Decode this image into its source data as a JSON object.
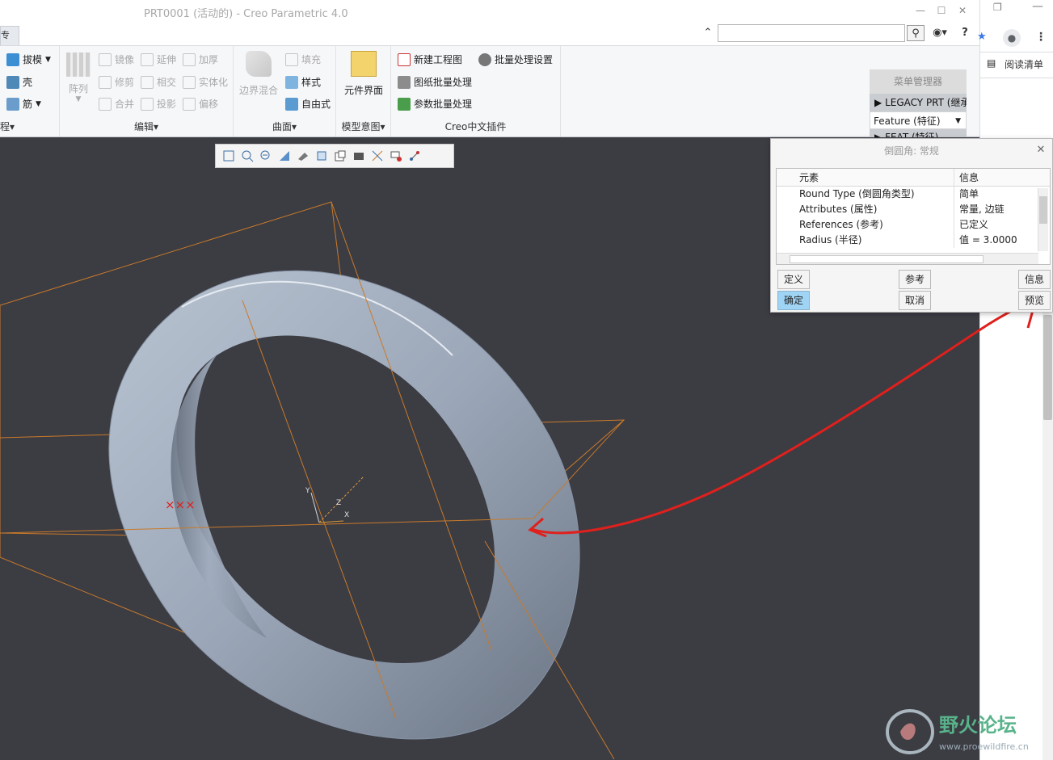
{
  "window": {
    "title": "PRT0001 (活动的) - Creo Parametric 4.0",
    "tab_stub": "专"
  },
  "ribbon": {
    "group0": {
      "label": "程",
      "items": [
        "拔模",
        "壳",
        "筋"
      ]
    },
    "group_edit": {
      "label": "编辑",
      "pattern": "阵列",
      "items": [
        "镜像",
        "延伸",
        "加厚",
        "修剪",
        "相交",
        "实体化",
        "合并",
        "投影",
        "偏移"
      ]
    },
    "group_surface": {
      "label": "曲面",
      "items": [
        "填充",
        "边界混合",
        "样式",
        "自由式"
      ]
    },
    "group_model": {
      "label": "模型意图",
      "big": "元件界面"
    },
    "group_creo": {
      "label": "Creo中文插件",
      "items": [
        "新建工程图",
        "批量处理设置",
        "图纸批量处理",
        "参数批量处理"
      ]
    }
  },
  "menu_manager": {
    "title": "菜单管理器",
    "item1": "LEGACY PRT (继承",
    "select": "Feature (特征)",
    "item2": "FEAT (特征)"
  },
  "browser": {
    "reading_list": "阅读清单"
  },
  "dialog": {
    "title": "倒圆角: 常规",
    "col_element": "元素",
    "col_info": "信息",
    "rows": [
      {
        "element": "Round Type (倒圆角类型)",
        "info": "简单"
      },
      {
        "element": "Attributes (属性)",
        "info": "常量, 边链"
      },
      {
        "element": "References (参考)",
        "info": "已定义"
      },
      {
        "element": "Radius (半径)",
        "info": "值 = 3.0000"
      }
    ],
    "buttons": {
      "define": "定义",
      "refs": "参考",
      "info": "信息",
      "ok": "确定",
      "cancel": "取消",
      "preview": "预览"
    }
  },
  "viewport": {
    "bg_color": "#3c3c43",
    "part_color": "#9aa6b5",
    "datum_color": "#c87a2a",
    "annotation_color": "#e0201c"
  },
  "watermark": {
    "text": "野火论坛",
    "url": "www.proewildfire.cn"
  }
}
